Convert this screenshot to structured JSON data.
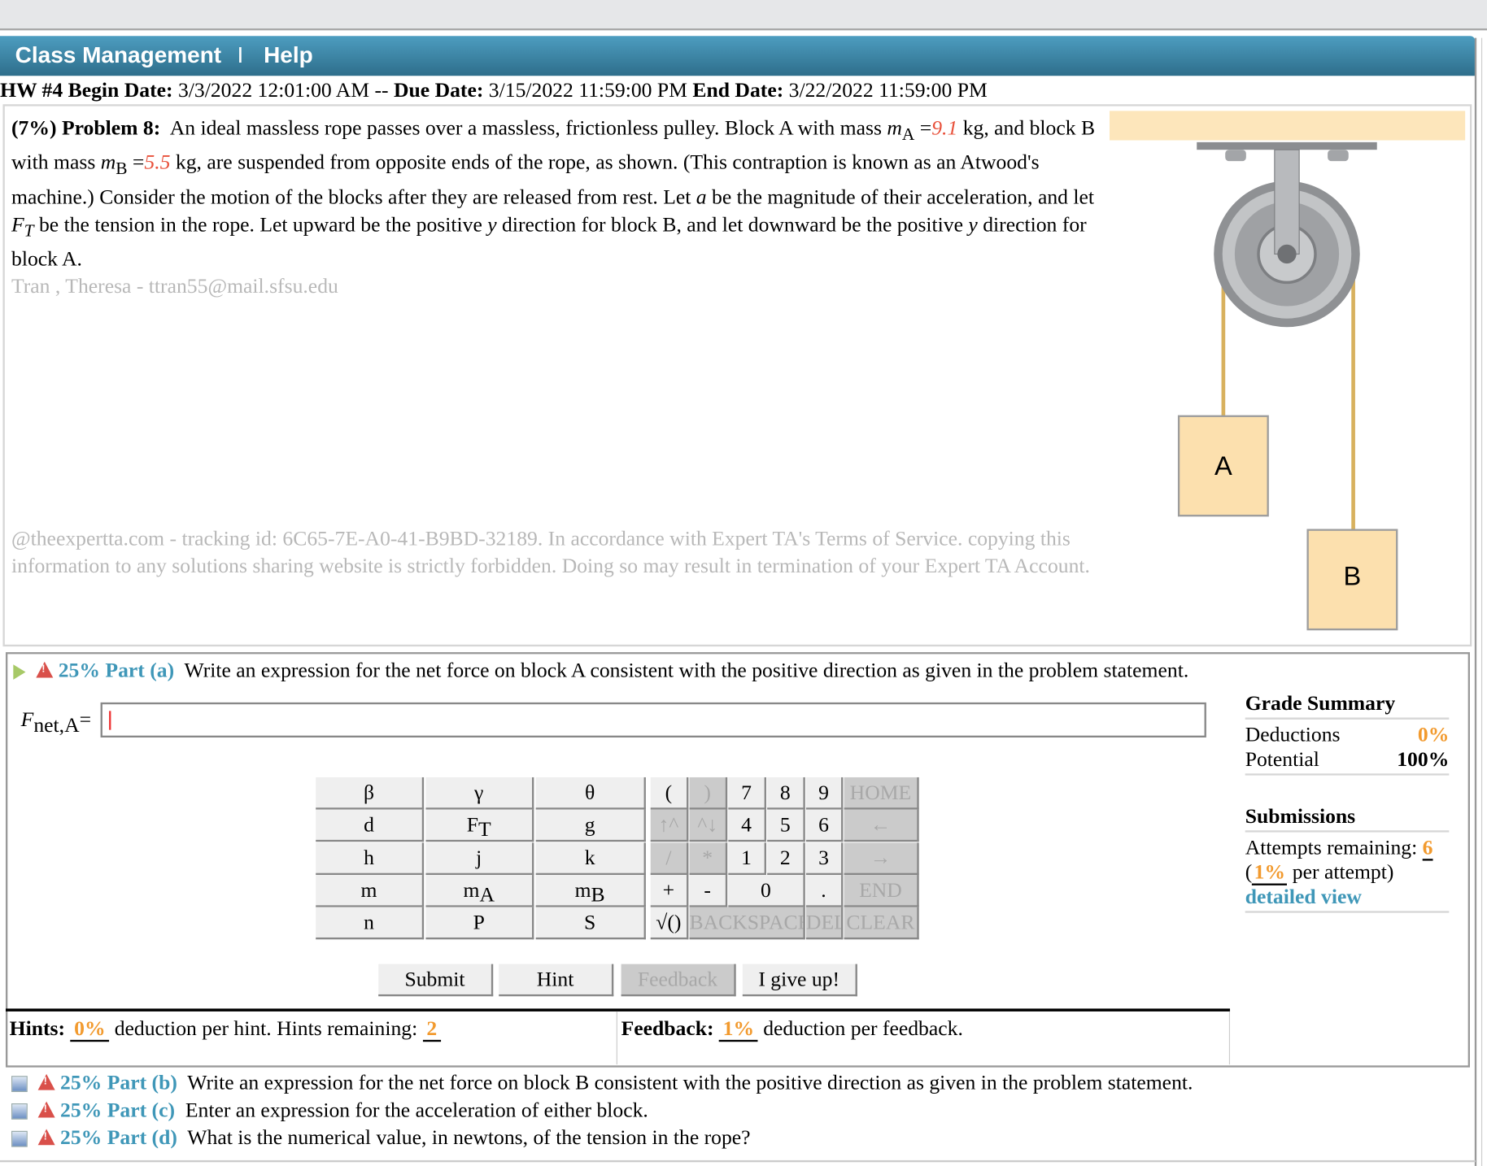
{
  "nav": {
    "class_management": "Class Management",
    "separator": "I",
    "help": "Help"
  },
  "dates": {
    "hw": "HW #4",
    "begin_label": "Begin Date:",
    "begin": "3/3/2022 12:01:00 AM --",
    "due_label": "Due Date:",
    "due": "3/15/2022 11:59:00 PM",
    "end_label": "End Date:",
    "end": "3/22/2022 11:59:00 PM"
  },
  "problem": {
    "weight": "(7%)",
    "title": "Problem 8:",
    "t1": "An ideal massless rope passes over a massless, frictionless pulley. Block A with mass ",
    "mA_sym": "m",
    "mA_sub": "A",
    "eq": " =",
    "mA_val": "9.1",
    "kg1": " kg,",
    "t2": "and block B with mass ",
    "mB_sym": "m",
    "mB_sub": "B",
    "mB_val": "5.5",
    "t3": " kg, are suspended from opposite ends of the rope, as shown. (This contraption is known as an Atwood's machine.) Consider the motion of the blocks after they are released from rest. Let ",
    "a": "a",
    "t4": " be the magnitude of their acceleration, and let ",
    "FT_sym": "F",
    "FT_sub": "T",
    "t5": " be the tension in the rope. Let upward be the positive ",
    "y": "y",
    "t6": " direction for block B, and let downward be the positive ",
    "t7": " direction for block A.",
    "student": "Tran , Theresa  - ttran55@mail.sfsu.edu",
    "notice": "@theexpertta.com - tracking id: 6C65-7E-A0-41-B9BD-32189. In accordance with Expert TA's Terms of Service. copying this information to any solutions sharing website is strictly forbidden. Doing so may result in termination of your Expert TA Account.",
    "figure": {
      "block_a": "A",
      "block_b": "B"
    }
  },
  "part_a": {
    "weight": "25%",
    "label": "Part (a)",
    "text": "Write an expression for the net force on block A consistent with the positive direction as given in the problem statement.",
    "var": "F",
    "var_sub": "net,A",
    "eq": "=",
    "value": ""
  },
  "keypad": {
    "vars": [
      [
        "β",
        "γ",
        "θ"
      ],
      [
        "d",
        "FT",
        "g"
      ],
      [
        "h",
        "j",
        "k"
      ],
      [
        "m",
        "mA",
        "mB"
      ],
      [
        "n",
        "P",
        "S"
      ]
    ],
    "ops": {
      "lparen": "(",
      "rparen": ")",
      "up": "↑^",
      "down": "^↓",
      "div": "/",
      "mul": "*",
      "plus": "+",
      "minus": "-",
      "sqrt": "√()",
      "dot": ".",
      "backspace": "BACKSPACE",
      "del": "DEL",
      "home": "HOME",
      "left": "←",
      "right": "→",
      "end": "END",
      "clear": "CLEAR"
    },
    "digits": [
      "7",
      "8",
      "9",
      "4",
      "5",
      "6",
      "1",
      "2",
      "3",
      "0"
    ]
  },
  "buttons": {
    "submit": "Submit",
    "hint": "Hint",
    "feedback": "Feedback",
    "give_up": "I give up!"
  },
  "hints": {
    "label": "Hints:",
    "deduction": "0%",
    "t1": "deduction per hint. Hints remaining:",
    "remaining": "2"
  },
  "feedback": {
    "label": "Feedback:",
    "deduction": "1%",
    "t1": "deduction per feedback."
  },
  "grade": {
    "title": "Grade Summary",
    "deductions_label": "Deductions",
    "deductions": "0%",
    "potential_label": "Potential",
    "potential": "100%"
  },
  "submissions": {
    "title": "Submissions",
    "attempts_label": "Attempts remaining:",
    "attempts": "6",
    "per_open": "(",
    "per": "1%",
    "per_text": "per attempt)",
    "detailed": "detailed view"
  },
  "parts": [
    {
      "weight": "25%",
      "label": "Part (b)",
      "text": "Write an expression for the net force on block B consistent with the positive direction as given in the problem statement."
    },
    {
      "weight": "25%",
      "label": "Part (c)",
      "text": "Enter an expression for the acceleration of either block."
    },
    {
      "weight": "25%",
      "label": "Part (d)",
      "text": "What is the numerical value, in newtons, of the tension in the rope?"
    }
  ],
  "colors": {
    "header": "#3d8aac",
    "accent": "#3f97b8",
    "orange": "#f29a2e",
    "red": "#e8503a"
  }
}
